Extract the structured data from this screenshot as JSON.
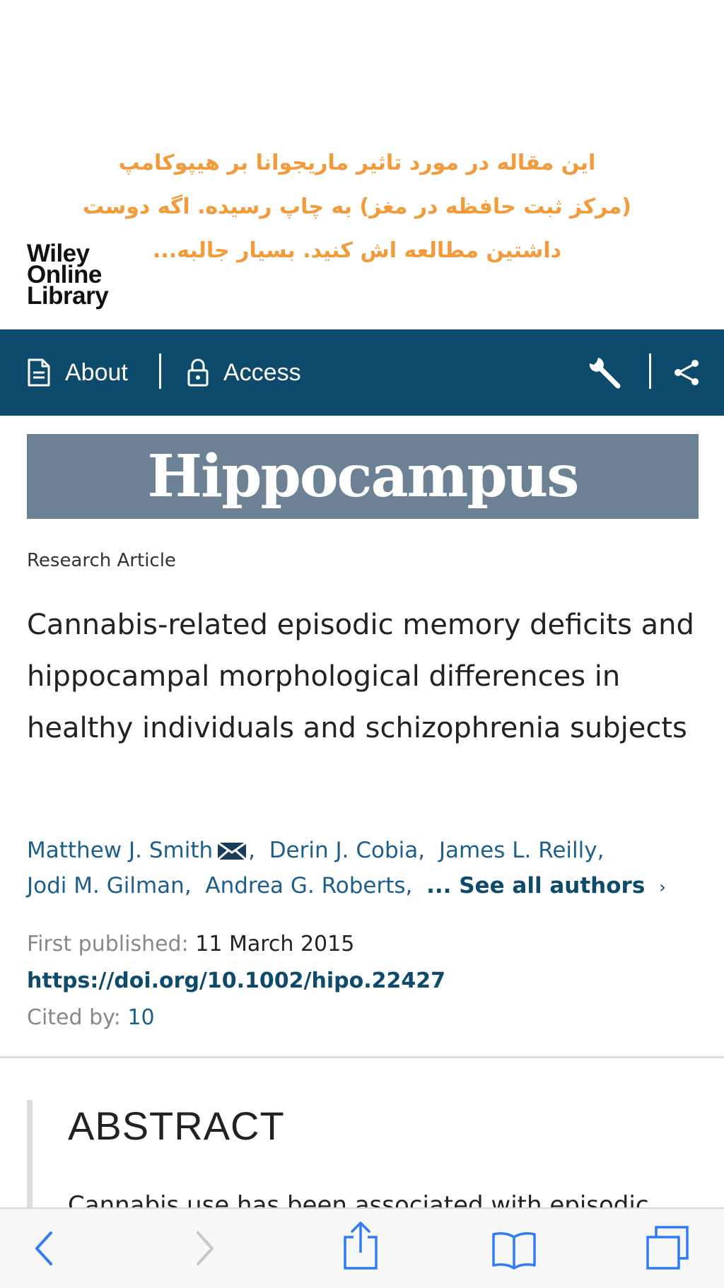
{
  "overlay_note": {
    "lines": [
      "این مقاله در مورد تاثیر ماریجوانا بر هیپوکامپ",
      "(مرکز ثبت حافظه در مغز) به چاپ رسیده. اگه دوست",
      "داشتین مطالعه اش کنید. بسیار جالبه..."
    ],
    "color": "#f39a3a"
  },
  "logo": {
    "lines": [
      "Wiley",
      "Online",
      "Library"
    ]
  },
  "navbar": {
    "about_label": "About",
    "access_label": "Access",
    "icons": [
      "document-icon",
      "lock-icon",
      "wrench-icon",
      "share-icon"
    ],
    "color": "#0d4a6b"
  },
  "journal": {
    "name": "Hippocampus",
    "banner_color": "#6c8193"
  },
  "article": {
    "type": "Research Article",
    "title": "Cannabis-related episodic memory deficits and hippocampal morphological differences in healthy individuals and schizophrenia subjects",
    "authors": [
      "Matthew J. Smith",
      "Derin J. Cobia",
      "James L. Reilly",
      "Jodi M. Gilman",
      "Andrea G. Roberts"
    ],
    "see_all_label": "... See all authors",
    "first_published_label": "First published:",
    "first_published_value": "11 March 2015",
    "doi": "https://doi.org/10.1002/hipo.22427",
    "cited_by_label": "Cited by:",
    "cited_by_value": "10"
  },
  "abstract": {
    "heading": "ABSTRACT",
    "text_start": "Cannabis use has been associated with episodic"
  },
  "toolbar": {
    "buttons": [
      "back-icon",
      "forward-icon",
      "share-icon",
      "bookmarks-icon",
      "tabs-icon"
    ],
    "accent": "#2f7cf6"
  }
}
